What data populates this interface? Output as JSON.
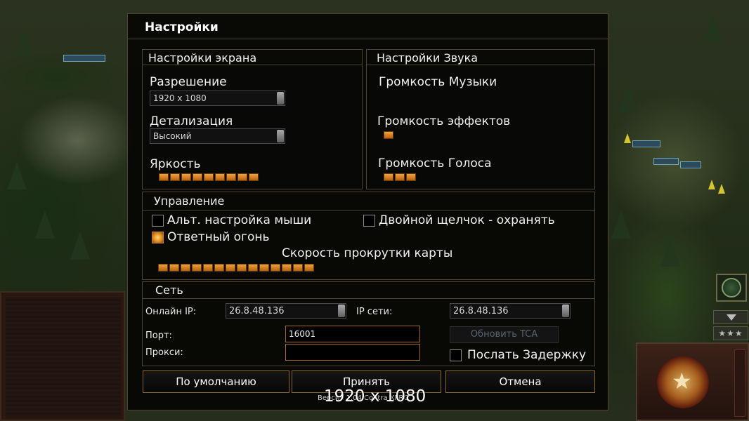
{
  "dialog": {
    "title": "Настройки"
  },
  "display": {
    "title": "Настройки экрана",
    "resolution": {
      "label": "Разрешение",
      "value": "1920 x 1080"
    },
    "detail": {
      "label": "Детализация",
      "value": "Высокий"
    },
    "brightness": {
      "label": "Яркость",
      "level": 9,
      "max": 9
    }
  },
  "sound": {
    "title": "Настройки Звука",
    "music": {
      "label": "Громкость Музыки",
      "level": 0
    },
    "effects": {
      "label": "Громкость эффектов",
      "level": 1
    },
    "voice": {
      "label": "Громкость Голоса",
      "level": 3
    }
  },
  "controls": {
    "title": "Управление",
    "alt_mouse": {
      "label": "Альт. настройка мыши",
      "checked": false
    },
    "double_click_guard": {
      "label": "Двойной щелчок - охранять",
      "checked": false
    },
    "return_fire": {
      "label": "Ответный огонь",
      "checked": true
    },
    "scroll_speed": {
      "label": "Скорость прокрутки карты",
      "level": 14
    }
  },
  "network": {
    "title": "Сеть",
    "online_ip": {
      "label": "Онлайн IP:",
      "value": "26.8.48.136"
    },
    "lan_ip": {
      "label": "IP сети:",
      "value": "26.8.48.136"
    },
    "port": {
      "label": "Порт:",
      "value": "16001"
    },
    "proxy": {
      "label": "Прокси:",
      "value": ""
    },
    "update_tca_label": "Обновить TCA",
    "send_delay": {
      "label": "Послать Задержку",
      "checked": false
    }
  },
  "buttons": {
    "defaults": "По умолчанию",
    "accept": "Принять",
    "cancel": "Отмена"
  },
  "overlay": {
    "resolution": "1920 x 1080",
    "version": "Версия 1.04 Contra XFRG"
  },
  "hud": {
    "stars": "★★★"
  },
  "colors": {
    "accent": "#8a6a33",
    "slider": "#e08c20",
    "panel_border": "#4e4530"
  }
}
